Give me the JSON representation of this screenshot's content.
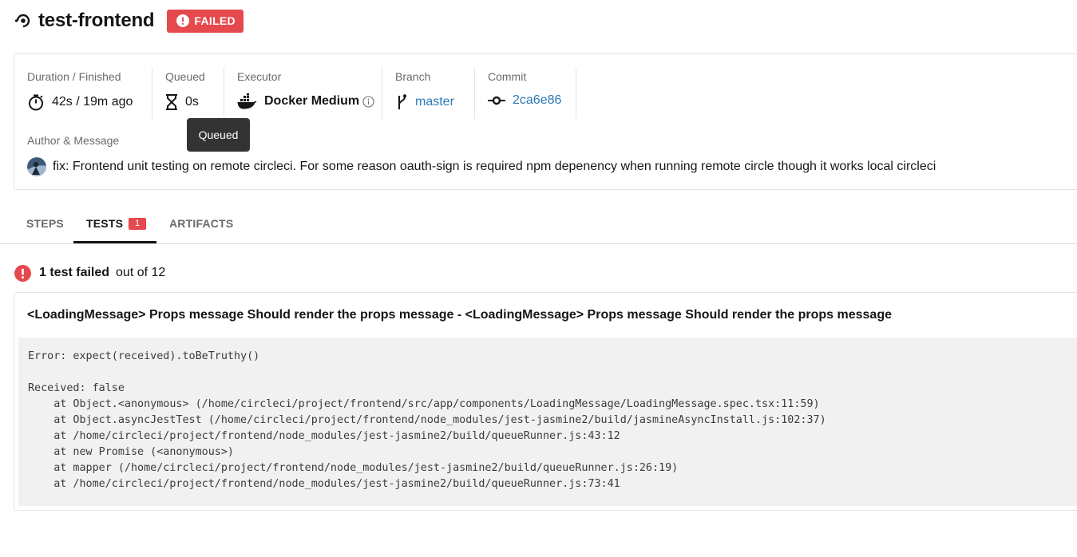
{
  "header": {
    "job_name": "test-frontend",
    "status": "FAILED",
    "status_color": "#e5484d"
  },
  "meta": {
    "duration": {
      "label": "Duration / Finished",
      "value": "42s / 19m ago",
      "icon": "stopwatch-icon"
    },
    "queued": {
      "label": "Queued",
      "value": "0s",
      "icon": "hourglass-icon"
    },
    "executor": {
      "label": "Executor",
      "value": "Docker Medium",
      "icon": "docker-icon"
    },
    "branch": {
      "label": "Branch",
      "value": "master",
      "icon": "git-branch-icon"
    },
    "commit": {
      "label": "Commit",
      "value": "2ca6e86",
      "icon": "git-commit-icon"
    },
    "author": {
      "label": "Author & Message",
      "message": "fix: Frontend unit testing on remote circleci. For some reason oauth-sign is required npm depenency when running remote circle though it works local circleci"
    }
  },
  "tooltip": {
    "text": "Queued"
  },
  "tabs": [
    {
      "label": "STEPS",
      "active": false
    },
    {
      "label": "TESTS",
      "active": true,
      "count": "1"
    },
    {
      "label": "ARTIFACTS",
      "active": false
    }
  ],
  "summary": {
    "failed": "1 test failed",
    "total": "out of 12"
  },
  "test": {
    "title": "<LoadingMessage> Props message Should render the props message - <LoadingMessage> Props message Should render the props message",
    "output": "Error: expect(received).toBeTruthy()\n\nReceived: false\n    at Object.<anonymous> (/home/circleci/project/frontend/src/app/components/LoadingMessage/LoadingMessage.spec.tsx:11:59)\n    at Object.asyncJestTest (/home/circleci/project/frontend/node_modules/jest-jasmine2/build/jasmineAsyncInstall.js:102:37)\n    at /home/circleci/project/frontend/node_modules/jest-jasmine2/build/queueRunner.js:43:12\n    at new Promise (<anonymous>)\n    at mapper (/home/circleci/project/frontend/node_modules/jest-jasmine2/build/queueRunner.js:26:19)\n    at /home/circleci/project/frontend/node_modules/jest-jasmine2/build/queueRunner.js:73:41"
  }
}
